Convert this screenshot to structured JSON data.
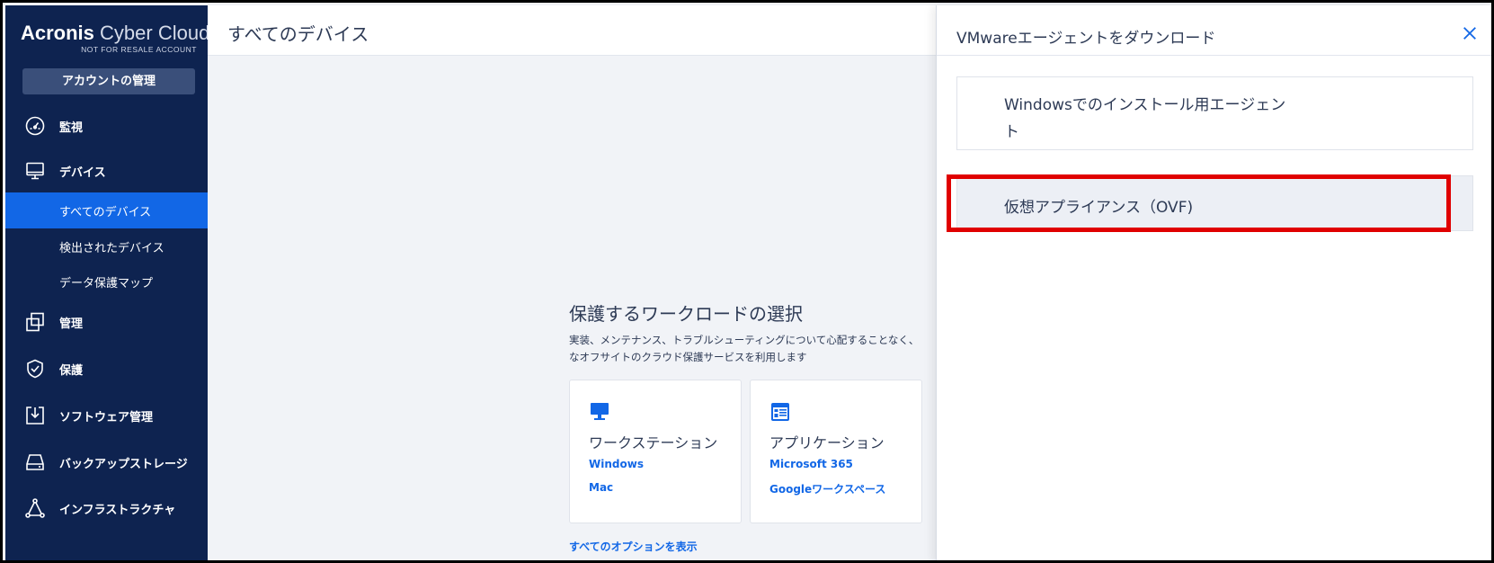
{
  "sidebar": {
    "brand_bold": "Acronis",
    "brand_light": " Cyber Cloud",
    "brand_sub": "NOT FOR RESALE ACCOUNT",
    "account_button": "アカウントの管理",
    "items": [
      {
        "label": "監視",
        "icon": "gauge-icon"
      },
      {
        "label": "デバイス",
        "icon": "monitor-icon"
      },
      {
        "label": "管理",
        "icon": "overlap-squares-icon"
      },
      {
        "label": "保護",
        "icon": "shield-check-icon"
      },
      {
        "label": "ソフトウェア管理",
        "icon": "download-tray-icon"
      },
      {
        "label": "バックアップストレージ",
        "icon": "storage-drive-icon"
      },
      {
        "label": "インフラストラクチャ",
        "icon": "network-triangle-icon"
      }
    ],
    "sub_items": [
      {
        "label": "すべてのデバイス",
        "active": true
      },
      {
        "label": "検出されたデバイス",
        "active": false
      },
      {
        "label": "データ保護マップ",
        "active": false
      }
    ]
  },
  "header": {
    "title": "すべてのデバイス"
  },
  "main": {
    "workload_title": "保護するワークロードの選択",
    "workload_desc_line1": "実装、メンテナンス、トラブルシューティングについて心配することなく、",
    "workload_desc_line2": "なオフサイトのクラウド保護サービスを利用します",
    "cards": [
      {
        "title": "ワークステーション",
        "icon": "desktop-icon",
        "links": [
          "Windows",
          "Mac"
        ]
      },
      {
        "title": "アプリケーション",
        "icon": "app-window-icon",
        "links": [
          "Microsoft 365",
          "Googleワークスペース"
        ]
      }
    ],
    "show_all": "すべてのオプションを表示"
  },
  "panel": {
    "title": "VMwareエージェントをダウンロード",
    "close_icon": "close-icon",
    "options": [
      {
        "label": "Windowsでのインストール用エージェント"
      },
      {
        "label": "仮想アプライアンス（OVF)"
      }
    ]
  },
  "colors": {
    "sidebar_bg": "#0e2350",
    "active_blue": "#1267e6",
    "highlight_red": "#e00000"
  }
}
